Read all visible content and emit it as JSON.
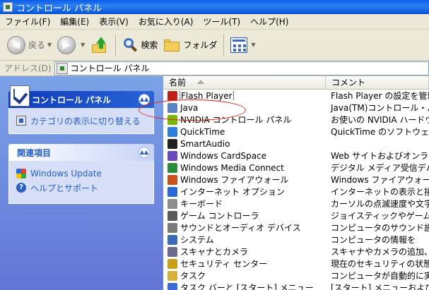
{
  "window": {
    "title": "コントロール パネル"
  },
  "menu": [
    "ファイル(F)",
    "編集(E)",
    "表示(V)",
    "お気に入り(A)",
    "ツール(T)",
    "ヘルプ(H)"
  ],
  "toolbar": {
    "back": "戻る",
    "search": "検索",
    "folders": "フォルダ"
  },
  "address": {
    "label": "アドレス(D)",
    "value": "コントロール パネル"
  },
  "left": {
    "panel1": {
      "title": "コントロール パネル",
      "link": "カテゴリの表示に切り替える"
    },
    "panel2": {
      "title": "関連項目",
      "links": [
        "Windows Update",
        "ヘルプとサポート"
      ]
    }
  },
  "columns": {
    "name": "名前",
    "comment": "コメント"
  },
  "items": [
    {
      "name": "Flash Player",
      "comment": "Flash Player の設定を管理",
      "icon": "flash-icon",
      "color": "#c0201a"
    },
    {
      "name": "Java",
      "comment": "Java(TM)コントロール・パネル",
      "icon": "java-icon",
      "color": "#5a82c0"
    },
    {
      "name": "NVIDIA コントロール パネル",
      "comment": "お使いの NVIDIA ハードウェア",
      "icon": "nvidia-icon",
      "color": "#76b900"
    },
    {
      "name": "QuickTime",
      "comment": "QuickTime のソフトウェアコン",
      "icon": "quicktime-icon",
      "color": "#2a7fd8"
    },
    {
      "name": "SmartAudio",
      "comment": "",
      "icon": "audio-icon",
      "color": "#222222"
    },
    {
      "name": "Windows CardSpace",
      "comment": "Web サイトおよびオンライン サ",
      "icon": "cardspace-icon",
      "color": "#6a4ab8"
    },
    {
      "name": "Windows Media Connect",
      "comment": "デジタル メディア受信デバイ",
      "icon": "media-connect-icon",
      "color": "#2a8a3a"
    },
    {
      "name": "Windows ファイアウォール",
      "comment": "Windows ファイアウォールを構",
      "icon": "firewall-icon",
      "color": "#c8501a"
    },
    {
      "name": "インターネット オプション",
      "comment": "インターネットの表示と接続設",
      "icon": "internet-icon",
      "color": "#2a6ad8"
    },
    {
      "name": "キーボード",
      "comment": "カーソルの点滅速度や文字の",
      "icon": "keyboard-icon",
      "color": "#8c8c8c"
    },
    {
      "name": "ゲーム コントローラ",
      "comment": "ジョイスティックやゲームパッドな",
      "icon": "gamepad-icon",
      "color": "#5a5a5a"
    },
    {
      "name": "サウンドとオーディオ デバイス",
      "comment": "コンピュータのサウンド設定を",
      "icon": "sound-icon",
      "color": "#7a7a7a"
    },
    {
      "name": "システム",
      "comment": "コンピュータの情報を",
      "icon": "system-icon",
      "color": "#3a6ab8"
    },
    {
      "name": "スキャナとカメラ",
      "comment": "スキャナやカメラの追加、削除",
      "icon": "scanner-icon",
      "color": "#6a6a8a"
    },
    {
      "name": "セキュリティ センター",
      "comment": "現在のセキュリティの状態を",
      "icon": "security-icon",
      "color": "#c8a018"
    },
    {
      "name": "タスク",
      "comment": "コンピュータが自動的に実行す",
      "icon": "tasks-icon",
      "color": "#d8b040"
    },
    {
      "name": "タスク バーと [スタート] メニュー",
      "comment": "[スタート] メニューおよびタス",
      "icon": "taskbar-icon",
      "color": "#3a6ad8"
    }
  ]
}
